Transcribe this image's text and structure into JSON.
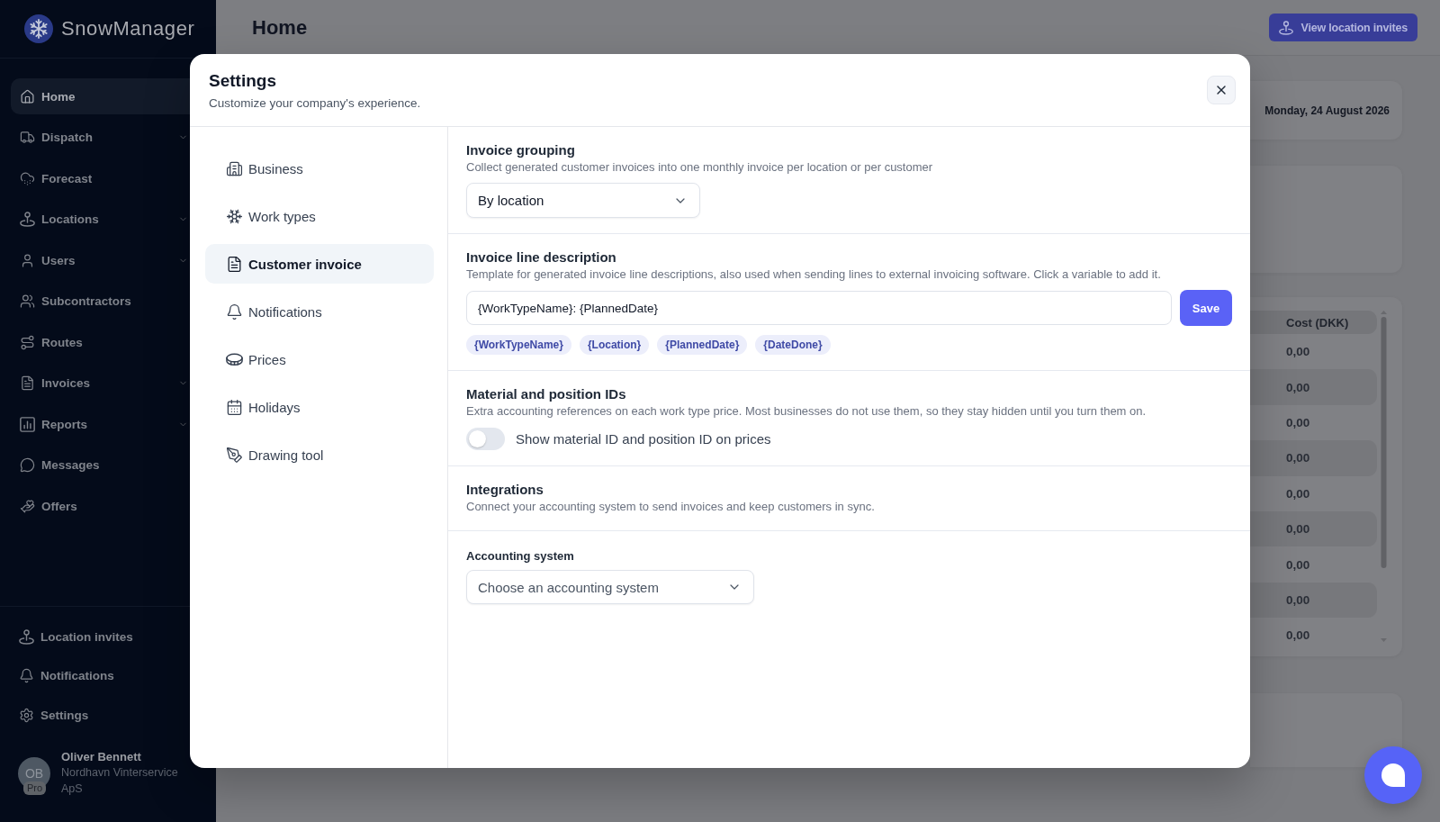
{
  "app": {
    "name": "SnowManager"
  },
  "sidebar": {
    "items": [
      {
        "label": "Home",
        "selected": true,
        "has_submenu": false
      },
      {
        "label": "Dispatch",
        "selected": false,
        "has_submenu": true
      },
      {
        "label": "Forecast",
        "selected": false,
        "has_submenu": false
      },
      {
        "label": "Locations",
        "selected": false,
        "has_submenu": true
      },
      {
        "label": "Users",
        "selected": false,
        "has_submenu": true
      },
      {
        "label": "Subcontractors",
        "selected": false,
        "has_submenu": false
      },
      {
        "label": "Routes",
        "selected": false,
        "has_submenu": false
      },
      {
        "label": "Invoices",
        "selected": false,
        "has_submenu": true
      },
      {
        "label": "Reports",
        "selected": false,
        "has_submenu": true
      },
      {
        "label": "Messages",
        "selected": false,
        "has_submenu": false
      },
      {
        "label": "Offers",
        "selected": false,
        "has_submenu": false
      }
    ],
    "footer_items": [
      {
        "label": "Location invites"
      },
      {
        "label": "Notifications"
      },
      {
        "label": "Settings"
      }
    ],
    "user": {
      "initials": "OB",
      "badge": "Pro",
      "name": "Oliver Bennett",
      "company": "Nordhavn Vinterservice ApS"
    }
  },
  "header": {
    "title": "Home",
    "action": "View location invites"
  },
  "dashboard": {
    "date": "Monday, 24 August 2026",
    "table": {
      "columns": [
        "Cost (DKK)"
      ],
      "rows": [
        [
          "0,00"
        ],
        [
          "0,00"
        ],
        [
          "0,00"
        ],
        [
          "0,00"
        ],
        [
          "0,00"
        ],
        [
          "0,00"
        ],
        [
          "0,00"
        ],
        [
          "0,00"
        ],
        [
          "0,00"
        ]
      ]
    }
  },
  "settings_dialog": {
    "title": "Settings",
    "subtitle": "Customize your company's experience.",
    "nav": [
      {
        "label": "Business",
        "selected": false
      },
      {
        "label": "Work types",
        "selected": false
      },
      {
        "label": "Customer invoice",
        "selected": true
      },
      {
        "label": "Notifications",
        "selected": false
      },
      {
        "label": "Prices",
        "selected": false
      },
      {
        "label": "Holidays",
        "selected": false
      },
      {
        "label": "Drawing tool",
        "selected": false
      }
    ],
    "sections": [
      {
        "kind": "select",
        "title": "Invoice grouping",
        "description": "Collect generated customer invoices into one monthly invoice per location or per customer",
        "value": "By location"
      },
      {
        "kind": "template",
        "title": "Invoice line description",
        "description": "Template for generated invoice line descriptions, also used when sending lines to external invoicing software. Click a variable to add it.",
        "value": "{WorkTypeName}: {PlannedDate}",
        "button": "Save",
        "variables": [
          "{WorkTypeName}",
          "{Location}",
          "{PlannedDate}",
          "{DateDone}"
        ]
      },
      {
        "kind": "toggle",
        "title": "Material and position IDs",
        "description": "Extra accounting references on each work type price. Most businesses do not use them, so they stay hidden until you turn them on.",
        "label": "Show material ID and position ID on prices",
        "on": false
      },
      {
        "kind": "heading",
        "title": "Integrations",
        "description": "Connect your accounting system to send invoices and keep customers in sync."
      },
      {
        "kind": "field",
        "label": "Accounting system",
        "placeholder": "Choose an accounting system"
      }
    ]
  }
}
